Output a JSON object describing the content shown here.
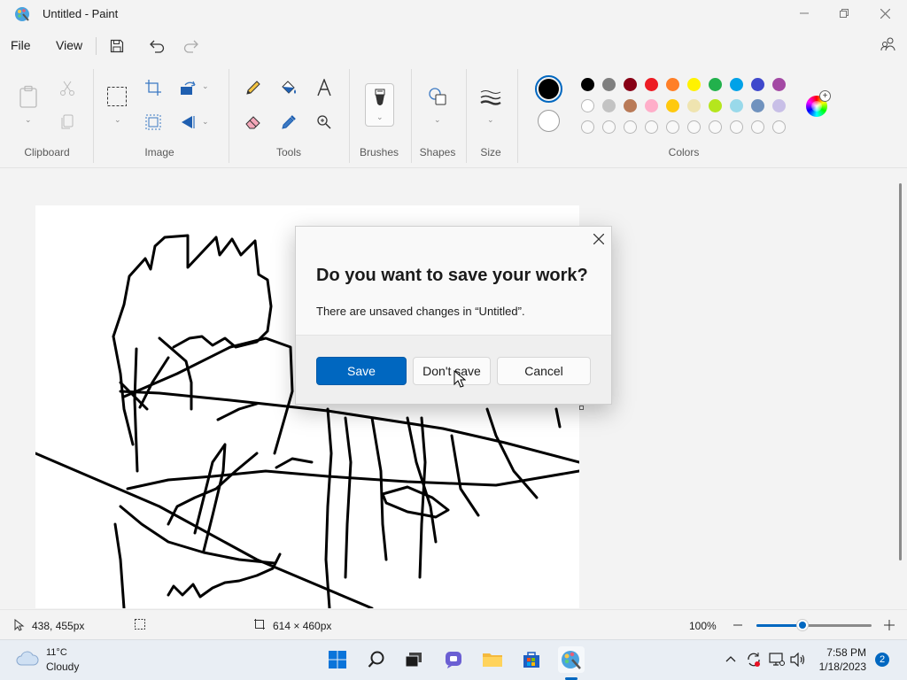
{
  "window": {
    "title": "Untitled - Paint"
  },
  "menu": {
    "file": "File",
    "view": "View"
  },
  "ribbon": {
    "groups": {
      "clipboard": "Clipboard",
      "image": "Image",
      "tools": "Tools",
      "brushes": "Brushes",
      "shapes": "Shapes",
      "size": "Size",
      "colors": "Colors"
    },
    "palette_row1": [
      "#000000",
      "#7f7f7f",
      "#880015",
      "#ed1c24",
      "#ff7f27",
      "#fff200",
      "#22b14c",
      "#00a2e8",
      "#3f48cc",
      "#a349a4"
    ],
    "palette_row2": [
      "#ffffff",
      "#c3c3c3",
      "#b97a57",
      "#ffaec9",
      "#ffc90e",
      "#efe4b0",
      "#b5e61d",
      "#99d9ea",
      "#7092be",
      "#c8bfe7"
    ],
    "primary_color": "#000000",
    "secondary_color": "#ffffff"
  },
  "dialog": {
    "title": "Do you want to save your work?",
    "message": "There are unsaved changes in “Untitled”.",
    "save": "Save",
    "dont_save": "Don't save",
    "cancel": "Cancel"
  },
  "status": {
    "cursor_pos": "438, 455px",
    "canvas_size": "614 × 460px",
    "zoom": "100%",
    "zoom_level": 0.4
  },
  "taskbar": {
    "weather_temp": "11°C",
    "weather_cond": "Cloudy",
    "time": "7:58 PM",
    "date": "1/18/2023",
    "notifications": "2"
  }
}
